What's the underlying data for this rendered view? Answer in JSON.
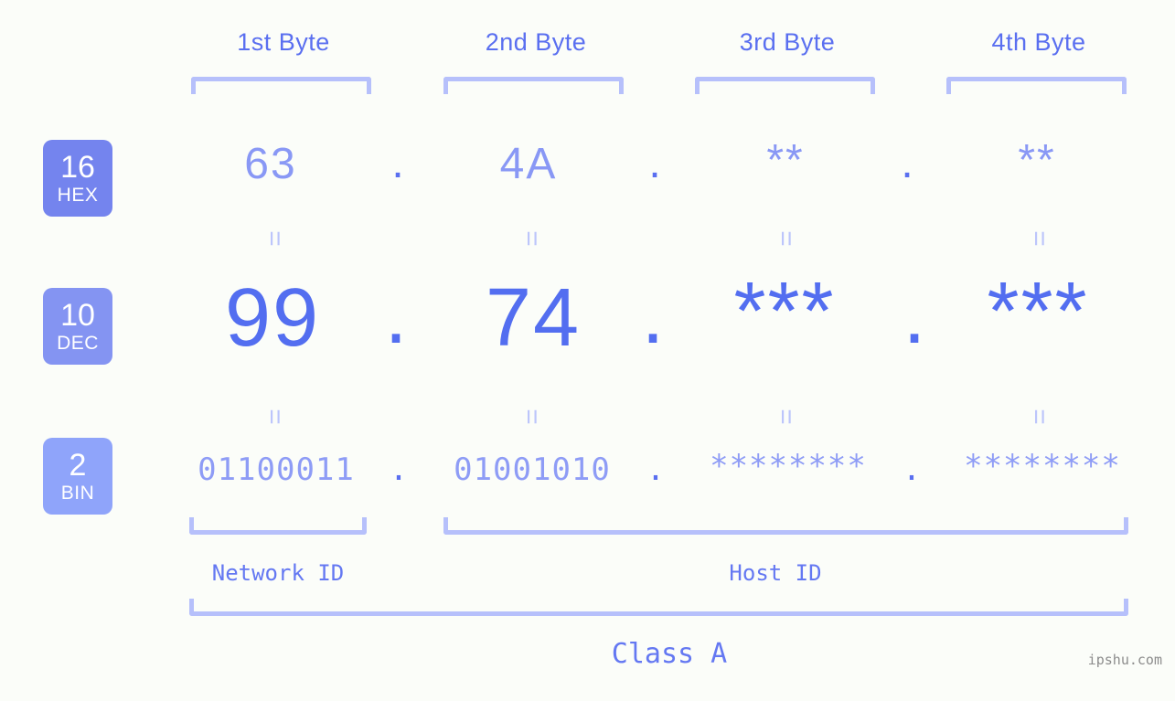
{
  "background_color": "#fbfdf9",
  "accent_color": "#536ef0",
  "accent_light": "#8998f5",
  "bracket_color": "#b6c0fb",
  "header": {
    "byte_labels": [
      {
        "label": "1st Byte"
      },
      {
        "label": "2nd Byte"
      },
      {
        "label": "3rd Byte"
      },
      {
        "label": "4th Byte"
      }
    ]
  },
  "bases": [
    {
      "number": "16",
      "name": "HEX",
      "color": "#7484ee"
    },
    {
      "number": "10",
      "name": "DEC",
      "color": "#8494f2"
    },
    {
      "number": "2",
      "name": "BIN",
      "color": "#8fa4fa"
    }
  ],
  "rows": {
    "hex": {
      "base": "16",
      "base_name": "HEX",
      "values": [
        "63",
        "4A",
        "**",
        "**"
      ],
      "separators": [
        ".",
        ".",
        "."
      ]
    },
    "dec": {
      "base": "10",
      "base_name": "DEC",
      "values": [
        "99",
        "74",
        "***",
        "***"
      ],
      "separators": [
        ".",
        ".",
        "."
      ]
    },
    "bin": {
      "base": "2",
      "base_name": "BIN",
      "values": [
        "01100011",
        "01001010",
        "********",
        "********"
      ],
      "separators": [
        ".",
        ".",
        "."
      ]
    }
  },
  "equality_marks": {
    "symbol": "=",
    "row1": [
      "=",
      "=",
      "=",
      "="
    ],
    "row2": [
      "=",
      "=",
      "=",
      "="
    ]
  },
  "footer": {
    "network_id_label": "Network ID",
    "host_id_label": "Host ID",
    "class_label": "Class A"
  },
  "watermark": "ipshu.com"
}
